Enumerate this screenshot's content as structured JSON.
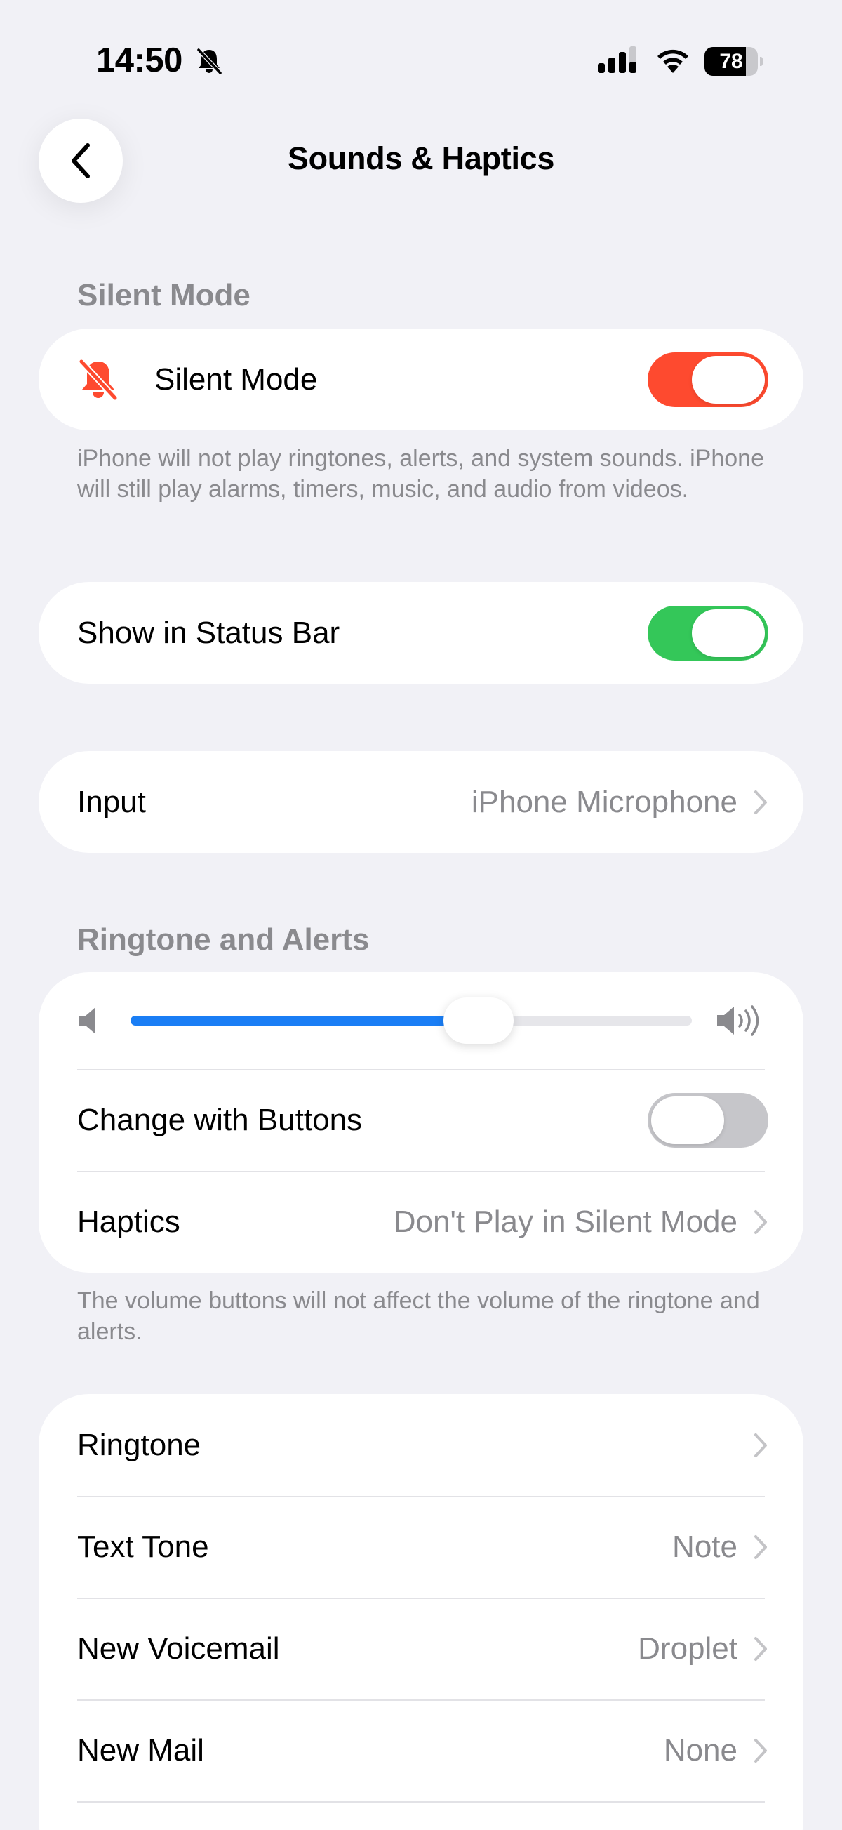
{
  "status_bar": {
    "time": "14:50",
    "battery": "78",
    "battery_level": 0.78
  },
  "nav": {
    "title": "Sounds & Haptics"
  },
  "silent_section": {
    "header": "Silent Mode",
    "silent_mode_label": "Silent Mode",
    "silent_mode_on": true,
    "note": "iPhone will not play ringtones, alerts, and system sounds. iPhone will still play alarms, timers, music, and audio from videos."
  },
  "status_bar_section": {
    "label": "Show in Status Bar",
    "on": true
  },
  "input_section": {
    "label": "Input",
    "value": "iPhone Microphone"
  },
  "ringtone_section": {
    "header": "Ringtone and Alerts",
    "volume_level": 0.62,
    "change_with_buttons_label": "Change with Buttons",
    "change_with_buttons_on": false,
    "haptics_label": "Haptics",
    "haptics_value": "Don't Play in Silent Mode",
    "note": "The volume buttons will not affect the volume of the ringtone and alerts."
  },
  "tones": [
    {
      "label": "Ringtone",
      "value": ""
    },
    {
      "label": "Text Tone",
      "value": "Note"
    },
    {
      "label": "New Voicemail",
      "value": "Droplet"
    },
    {
      "label": "New Mail",
      "value": "None"
    }
  ],
  "colors": {
    "silent_toggle": "#fe4a2f",
    "status_toggle": "#34c759",
    "off_toggle": "#c6c6ca",
    "slider": "#1a7ef5",
    "silent_icon": "#fe4a2f"
  }
}
